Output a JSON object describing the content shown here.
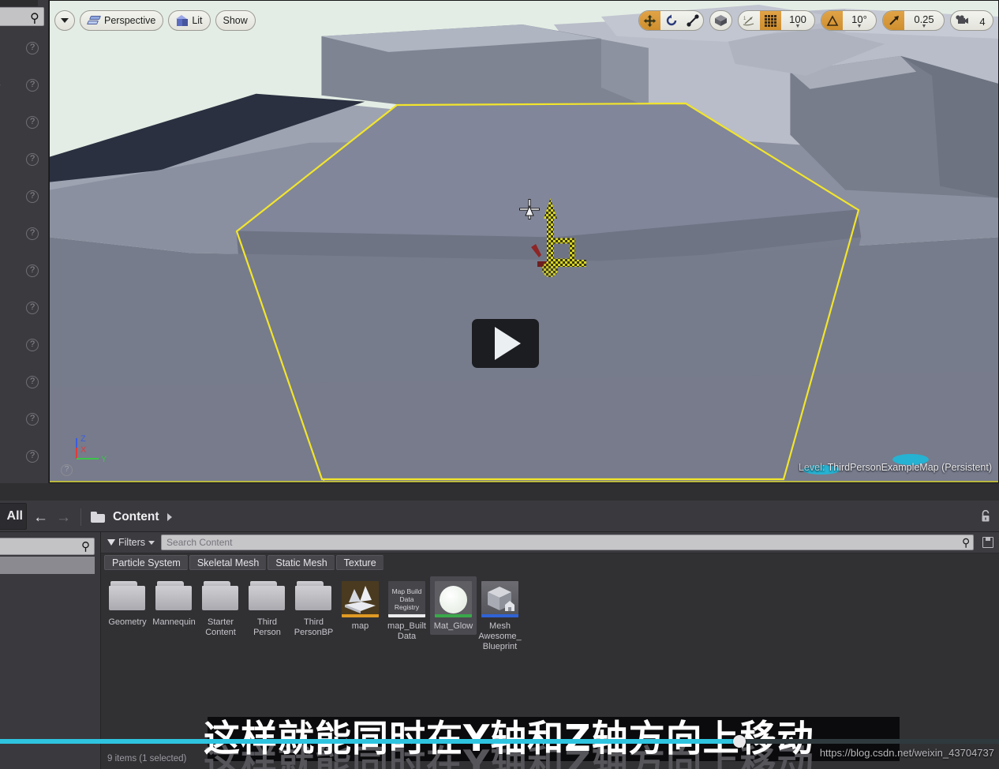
{
  "viewport": {
    "toolbar_left": [
      {
        "name": "viewport-options",
        "icon": "chevron-down-icon",
        "label": ""
      },
      {
        "name": "view-perspective",
        "icon": "perspective-icon",
        "label": "Perspective"
      },
      {
        "name": "view-mode-lit",
        "icon": "cube-icon",
        "label": "Lit"
      },
      {
        "name": "show-flags",
        "icon": "",
        "label": "Show"
      }
    ],
    "toolbar_right": {
      "transform_tools": [
        {
          "name": "translate-tool",
          "icon": "move-icon",
          "active": true
        },
        {
          "name": "rotate-tool",
          "icon": "rotate-icon",
          "active": false
        },
        {
          "name": "scale-tool",
          "icon": "scale-icon",
          "active": false
        }
      ],
      "coordinate_system": {
        "name": "world-coordinate-toggle",
        "icon": "cube-icon"
      },
      "surface_snap": {
        "name": "surface-snap-toggle",
        "icon": "surface-snap-icon"
      },
      "grid_snap": {
        "name": "grid-snap-toggle",
        "icon": "grid-icon",
        "active": true,
        "value": "100"
      },
      "angle_snap": {
        "name": "angle-snap-toggle",
        "icon": "angle-icon",
        "active": true,
        "value": "10°"
      },
      "scale_snap": {
        "name": "scale-snap-toggle",
        "icon": "scale-snap-icon",
        "active": true,
        "value": "0.25"
      },
      "camera_speed": {
        "name": "camera-speed",
        "icon": "camera-icon",
        "value": "4"
      }
    },
    "axis_indicator": {
      "z": "Z",
      "x": "X",
      "y": "Y"
    },
    "level_prefix": "Level:",
    "level_name": "ThirdPersonExampleMap (Persistent)",
    "help_icon": "question-mark-icon",
    "colors": {
      "sky": "#e2ece4",
      "selection_outline": "#f2e52b",
      "axis_x": "#e03b3b",
      "axis_y": "#3cc44a",
      "axis_z": "#3b5de0",
      "gizmo_highlight": "#d8d420"
    }
  },
  "left_panel": {
    "cut_label": "r",
    "search_placeholder": "",
    "help_icon": "question-mark-icon",
    "help_icon_count": 12
  },
  "content_browser": {
    "all_button": "All",
    "nav": {
      "back": "←",
      "forward": "→"
    },
    "breadcrumb": {
      "folder_icon": "folder-icon",
      "label": "Content",
      "caret": "chevron-right-icon"
    },
    "lock_icon": "lock-icon",
    "filters_label": "Filters",
    "search_placeholder": "Search Content",
    "search_icon": "search-icon",
    "save_icon": "save-icon",
    "filter_pills": [
      "Particle System",
      "Skeletal Mesh",
      "Static Mesh",
      "Texture"
    ],
    "assets": [
      {
        "name": "Geometry",
        "type": "folder"
      },
      {
        "name": "Mannequin",
        "type": "folder"
      },
      {
        "name": "Starter Content",
        "type": "folder"
      },
      {
        "name": "Third Person",
        "type": "folder"
      },
      {
        "name": "Third PersonBP",
        "type": "folder"
      },
      {
        "name": "map",
        "type": "level",
        "bar_color": "#e09a23",
        "selected": false
      },
      {
        "name": "map_Built Data",
        "type": "mapbuilddata",
        "thumb_text": "Map Build Data Registry",
        "bar_color": "#ececee",
        "selected": false
      },
      {
        "name": "Mat_Glow",
        "type": "material",
        "bar_color": "#3aa84a",
        "selected": true
      },
      {
        "name": "Mesh Awesome_ Blueprint",
        "type": "blueprint",
        "bar_color": "#2f63d6",
        "selected": false
      }
    ],
    "status": "9 items (1 selected)"
  },
  "video_overlay": {
    "play_icon": "play-icon",
    "subtitle": "这样就能同时在Y轴和Z轴方向上移动",
    "progress_percent": 74,
    "progress_color": "#2ec4e0",
    "watermark": "https://blog.csdn.net/weixin_43704737"
  }
}
